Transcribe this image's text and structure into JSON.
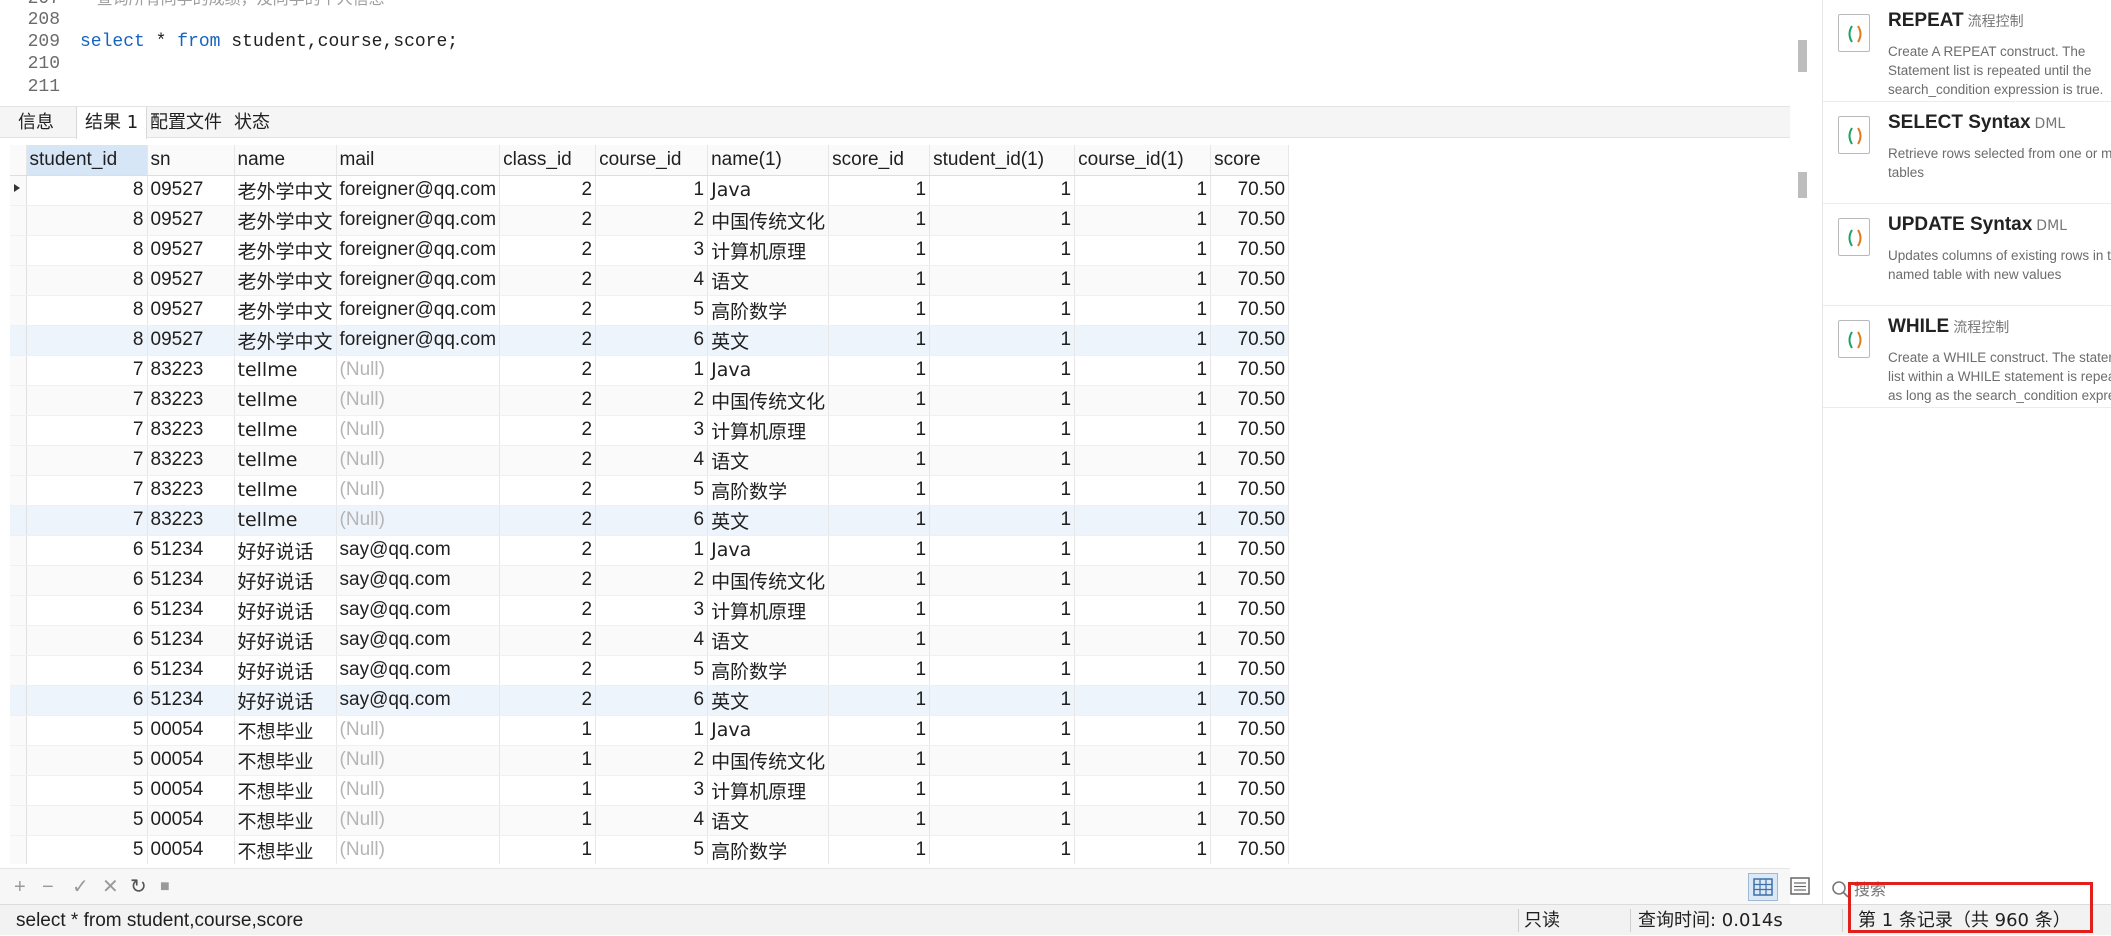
{
  "editor": {
    "lines": [
      {
        "num": "207",
        "text": "-- 查询所有同学的成绩，及同学的个人信息",
        "type": "comment"
      },
      {
        "num": "208",
        "text": "",
        "type": "plain"
      },
      {
        "num": "209",
        "text": "",
        "type": "sql"
      },
      {
        "num": "210",
        "text": "",
        "type": "plain"
      },
      {
        "num": "211",
        "text": "",
        "type": "plain"
      }
    ],
    "sql_tokens": {
      "kw1": "select",
      "star": " * ",
      "kw2": "from",
      "rest": " student,course,score;"
    }
  },
  "tabs": [
    {
      "label": "信息",
      "active": false
    },
    {
      "label": "结果 1",
      "active": true
    },
    {
      "label": "配置文件",
      "active": false
    },
    {
      "label": "状态",
      "active": false
    }
  ],
  "grid": {
    "columns": [
      "student_id",
      "sn",
      "name",
      "mail",
      "class_id",
      "course_id",
      "name(1)",
      "score_id",
      "student_id(1)",
      "course_id(1)",
      "score"
    ],
    "rows": [
      [
        "8",
        "09527",
        "老外学中文",
        "foreigner@qq.com",
        "2",
        "1",
        "Java",
        "1",
        "1",
        "1",
        "70.50"
      ],
      [
        "8",
        "09527",
        "老外学中文",
        "foreigner@qq.com",
        "2",
        "2",
        "中国传统文化",
        "1",
        "1",
        "1",
        "70.50"
      ],
      [
        "8",
        "09527",
        "老外学中文",
        "foreigner@qq.com",
        "2",
        "3",
        "计算机原理",
        "1",
        "1",
        "1",
        "70.50"
      ],
      [
        "8",
        "09527",
        "老外学中文",
        "foreigner@qq.com",
        "2",
        "4",
        "语文",
        "1",
        "1",
        "1",
        "70.50"
      ],
      [
        "8",
        "09527",
        "老外学中文",
        "foreigner@qq.com",
        "2",
        "5",
        "高阶数学",
        "1",
        "1",
        "1",
        "70.50"
      ],
      [
        "8",
        "09527",
        "老外学中文",
        "foreigner@qq.com",
        "2",
        "6",
        "英文",
        "1",
        "1",
        "1",
        "70.50"
      ],
      [
        "7",
        "83223",
        "tellme",
        "(Null)",
        "2",
        "1",
        "Java",
        "1",
        "1",
        "1",
        "70.50"
      ],
      [
        "7",
        "83223",
        "tellme",
        "(Null)",
        "2",
        "2",
        "中国传统文化",
        "1",
        "1",
        "1",
        "70.50"
      ],
      [
        "7",
        "83223",
        "tellme",
        "(Null)",
        "2",
        "3",
        "计算机原理",
        "1",
        "1",
        "1",
        "70.50"
      ],
      [
        "7",
        "83223",
        "tellme",
        "(Null)",
        "2",
        "4",
        "语文",
        "1",
        "1",
        "1",
        "70.50"
      ],
      [
        "7",
        "83223",
        "tellme",
        "(Null)",
        "2",
        "5",
        "高阶数学",
        "1",
        "1",
        "1",
        "70.50"
      ],
      [
        "7",
        "83223",
        "tellme",
        "(Null)",
        "2",
        "6",
        "英文",
        "1",
        "1",
        "1",
        "70.50"
      ],
      [
        "6",
        "51234",
        "好好说话",
        "say@qq.com",
        "2",
        "1",
        "Java",
        "1",
        "1",
        "1",
        "70.50"
      ],
      [
        "6",
        "51234",
        "好好说话",
        "say@qq.com",
        "2",
        "2",
        "中国传统文化",
        "1",
        "1",
        "1",
        "70.50"
      ],
      [
        "6",
        "51234",
        "好好说话",
        "say@qq.com",
        "2",
        "3",
        "计算机原理",
        "1",
        "1",
        "1",
        "70.50"
      ],
      [
        "6",
        "51234",
        "好好说话",
        "say@qq.com",
        "2",
        "4",
        "语文",
        "1",
        "1",
        "1",
        "70.50"
      ],
      [
        "6",
        "51234",
        "好好说话",
        "say@qq.com",
        "2",
        "5",
        "高阶数学",
        "1",
        "1",
        "1",
        "70.50"
      ],
      [
        "6",
        "51234",
        "好好说话",
        "say@qq.com",
        "2",
        "6",
        "英文",
        "1",
        "1",
        "1",
        "70.50"
      ],
      [
        "5",
        "00054",
        "不想毕业",
        "(Null)",
        "1",
        "1",
        "Java",
        "1",
        "1",
        "1",
        "70.50"
      ],
      [
        "5",
        "00054",
        "不想毕业",
        "(Null)",
        "1",
        "2",
        "中国传统文化",
        "1",
        "1",
        "1",
        "70.50"
      ],
      [
        "5",
        "00054",
        "不想毕业",
        "(Null)",
        "1",
        "3",
        "计算机原理",
        "1",
        "1",
        "1",
        "70.50"
      ],
      [
        "5",
        "00054",
        "不想毕业",
        "(Null)",
        "1",
        "4",
        "语文",
        "1",
        "1",
        "1",
        "70.50"
      ],
      [
        "5",
        "00054",
        "不想毕业",
        "(Null)",
        "1",
        "5",
        "高阶数学",
        "1",
        "1",
        "1",
        "70.50"
      ]
    ]
  },
  "toolbar": {
    "add": "+",
    "remove": "−",
    "apply": "✓",
    "discard": "✕",
    "refresh": "↻",
    "stop": "■"
  },
  "status": {
    "sql": "select * from student,course,score",
    "readonly": "只读",
    "query_time": "查询时间: 0.014s",
    "records": "第 1 条记录（共 960 条）"
  },
  "panel": {
    "cards": [
      {
        "title": "REPEAT",
        "tag": "流程控制",
        "desc": "Create A REPEAT construct. The Statement list is repeated until the search_condition expression is true."
      },
      {
        "title": "SELECT Syntax",
        "tag": "DML",
        "desc": "Retrieve rows selected from one or more tables"
      },
      {
        "title": "UPDATE Syntax",
        "tag": "DML",
        "desc": "Updates columns of existing rows in the named table with new values"
      },
      {
        "title": "WHILE",
        "tag": "流程控制",
        "desc": "Create a WHILE construct. The statement list within a WHILE statement is repeated as long as the search_condition expression is true."
      }
    ],
    "search_placeholder": "搜索"
  },
  "colors": {
    "keyword": "#1565c0",
    "null_text": "#b5b5b5",
    "highlight_box": "#e0201a",
    "selected_header": "#d6e6f7"
  },
  "icons": [
    "run-icon",
    "grid-view-icon",
    "form-view-icon",
    "search-icon",
    "snippet-icon"
  ]
}
